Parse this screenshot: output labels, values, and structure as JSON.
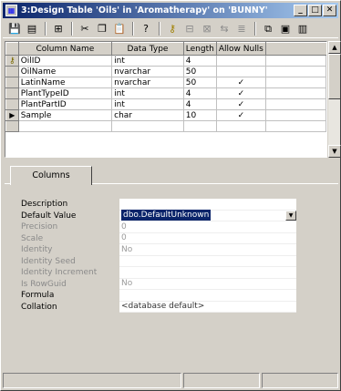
{
  "window": {
    "title": "3:Design Table 'Oils' in 'Aromatherapy' on 'BUNNY'",
    "buttons": {
      "minimize": "_",
      "maximize": "□",
      "close": "✕"
    }
  },
  "toolbar": {
    "icons": [
      "save-icon",
      "properties-icon",
      "table-icon",
      "cut-icon",
      "copy-icon",
      "paste-icon",
      "help-icon",
      "set-primary-key-icon",
      "insert-column-icon",
      "delete-column-icon",
      "relationships-icon",
      "indexes-icon",
      "constraints-icon",
      "generate-script-icon"
    ]
  },
  "grid": {
    "headers": [
      "Column Name",
      "Data Type",
      "Length",
      "Allow Nulls"
    ],
    "rows": [
      {
        "marker": "key",
        "name": "OilID",
        "type": "int",
        "length": "4",
        "nulls": ""
      },
      {
        "marker": "",
        "name": "OilName",
        "type": "nvarchar",
        "length": "50",
        "nulls": ""
      },
      {
        "marker": "",
        "name": "LatinName",
        "type": "nvarchar",
        "length": "50",
        "nulls": "✓"
      },
      {
        "marker": "",
        "name": "PlantTypeID",
        "type": "int",
        "length": "4",
        "nulls": "✓"
      },
      {
        "marker": "",
        "name": "PlantPartID",
        "type": "int",
        "length": "4",
        "nulls": "✓"
      },
      {
        "marker": "current",
        "name": "Sample",
        "type": "char",
        "length": "10",
        "nulls": "✓"
      }
    ]
  },
  "tabs": {
    "columns": "Columns"
  },
  "properties": [
    {
      "label": "Description",
      "value": "",
      "disabled": false
    },
    {
      "label": "Default Value",
      "value": "dbo.DefaultUnknown",
      "disabled": false,
      "selected": true
    },
    {
      "label": "Precision",
      "value": "0",
      "disabled": true
    },
    {
      "label": "Scale",
      "value": "0",
      "disabled": true
    },
    {
      "label": "Identity",
      "value": "No",
      "disabled": true
    },
    {
      "label": "Identity Seed",
      "value": "",
      "disabled": true
    },
    {
      "label": "Identity Increment",
      "value": "",
      "disabled": true
    },
    {
      "label": "Is RowGuid",
      "value": "No",
      "disabled": true
    },
    {
      "label": "Formula",
      "value": "",
      "disabled": false
    },
    {
      "label": "Collation",
      "value": "<database default>",
      "disabled": false
    }
  ]
}
